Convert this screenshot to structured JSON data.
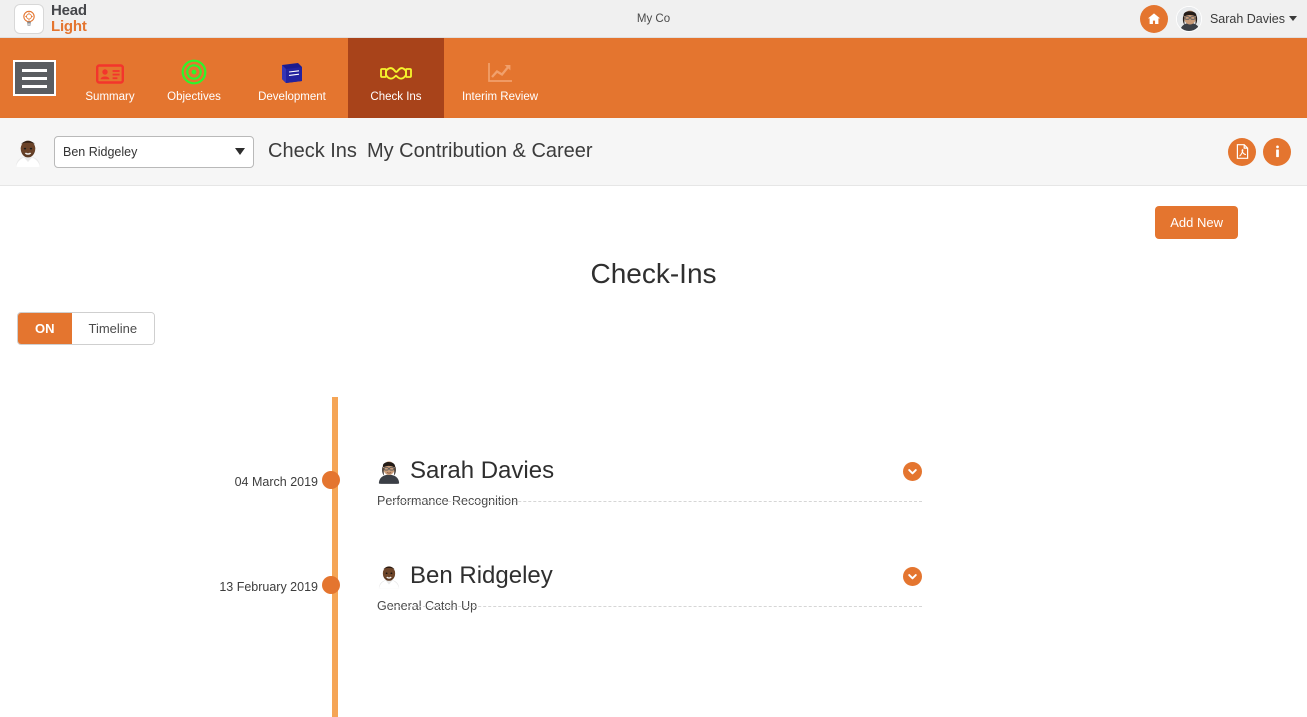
{
  "header": {
    "logo": {
      "line1": "Head",
      "line2": "Light",
      "icon": "lightbulb-icon"
    },
    "company": "My Co",
    "home_icon": "home-icon",
    "user": {
      "name": "Sarah Davies",
      "avatar": "user-avatar"
    }
  },
  "main_nav": {
    "menu_icon": "hamburger-menu-icon",
    "tabs": [
      {
        "label": "Summary",
        "icon": "id-card-icon",
        "active": false
      },
      {
        "label": "Objectives",
        "icon": "target-icon",
        "active": false
      },
      {
        "label": "Development",
        "icon": "book-icon",
        "active": false
      },
      {
        "label": "Check Ins",
        "icon": "handshake-icon",
        "active": true
      },
      {
        "label": "Interim Review",
        "icon": "chart-line-icon",
        "active": false
      }
    ]
  },
  "sub_header": {
    "person_avatar": "person-avatar",
    "person_selected": "Ben Ridgeley",
    "breadcrumb_main": "Check Ins",
    "breadcrumb_sub": "My Contribution & Career",
    "actions": [
      {
        "name": "export-pdf-button",
        "icon": "pdf-file-icon"
      },
      {
        "name": "info-button",
        "icon": "info-icon"
      }
    ]
  },
  "content": {
    "add_new_label": "Add New",
    "page_title": "Check-Ins",
    "view_toggle": [
      {
        "label": "ON",
        "active": true
      },
      {
        "label": "Timeline",
        "active": false
      }
    ],
    "entries": [
      {
        "date": "04 March 2019",
        "person": "Sarah Davies",
        "type": "Performance Recognition",
        "expand_icon": "chevron-down-icon"
      },
      {
        "date": "13 February 2019",
        "person": "Ben Ridgeley",
        "type": "General Catch Up",
        "expand_icon": "chevron-down-icon"
      }
    ]
  },
  "colors": {
    "brand_orange": "#e4752f",
    "active_tab": "#a8431a",
    "timeline_line": "#f5a556",
    "header_bg": "#f0f0f0",
    "subheader_bg": "#f6f6f6"
  }
}
